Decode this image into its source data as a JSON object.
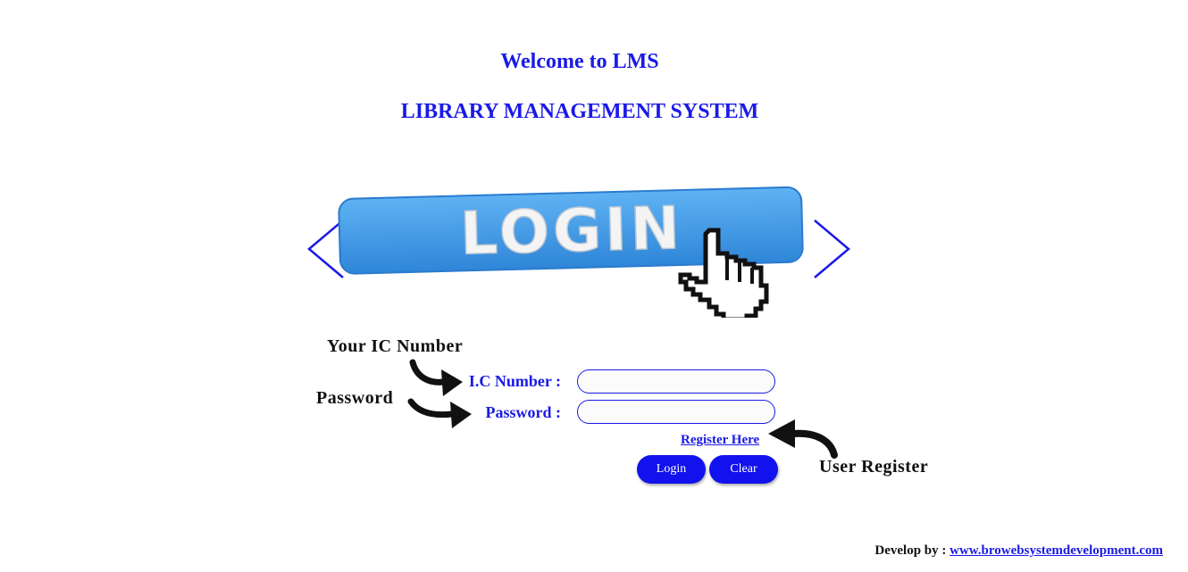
{
  "header": {
    "welcome": "Welcome to LMS",
    "system_name": "LIBRARY MANAGEMENT SYSTEM"
  },
  "banner": {
    "text": "LOGIN",
    "color": "#3d9ae8",
    "chevron_color": "#1a1ae6"
  },
  "callouts": {
    "ic": "Your IC Number",
    "password": "Password",
    "register": "User Register"
  },
  "form": {
    "ic_label": "I.C Number :",
    "ic_value": "",
    "password_label": "Password :",
    "password_value": "",
    "register_link": "Register Here",
    "login_button": "Login",
    "clear_button": "Clear"
  },
  "footer": {
    "prefix": "Develop by :",
    "link_text": "www.browebsystemdevelopment.com"
  },
  "colors": {
    "accent": "#1a1ae6",
    "button": "#1212ee"
  }
}
